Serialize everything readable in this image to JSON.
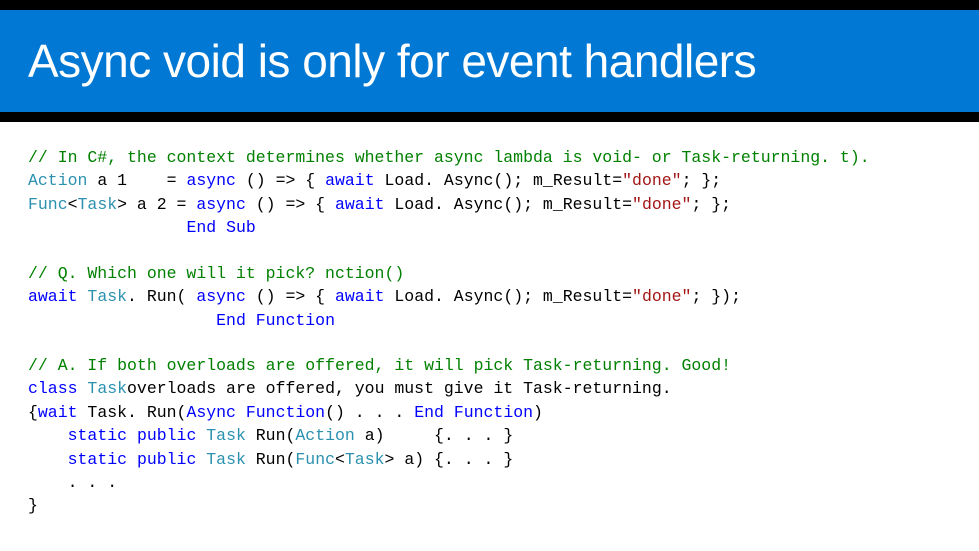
{
  "header": {
    "title": "Async void is only for event handlers"
  },
  "code": {
    "b1": {
      "c1": "// In C#, the context determines whether async lambda is void- or Task-returning. t).",
      "t_action": "Action",
      "l2_a": " a 1    = ",
      "k_async": "async",
      "l2_b": " () => { ",
      "k_await": "await",
      "l2_c": " Load. Async(); m_Result=",
      "s_done": "\"done\"",
      "l2_d": "; };",
      "t_func": "Func",
      "t_task": "Task",
      "lt": "<",
      "gt": ">",
      "l3_a": " a 2 = ",
      "l3_b": " () => { ",
      "l3_c": " Load. Async(); m_Result=",
      "l3_d": "; };",
      "l4_pad": "                ",
      "k_end": "End",
      "sp": " ",
      "k_sub": "Sub"
    },
    "b2": {
      "c1": "// Q. Which one will it pick? nction()",
      "k_await": "await",
      "sp": " ",
      "t_task": "Task",
      "l2_a": ". Run( ",
      "k_async": "async",
      "l2_b": " () => { ",
      "l2_c": " Load. Async(); m_Result=",
      "s_done": "\"done\"",
      "l2_d": "; });",
      "l3_pad": "                   ",
      "k_end": "End",
      "k_function": "Function"
    },
    "b3": {
      "c1": "// A. If both overloads are offered, it will pick Task-returning. Good!",
      "k_class": "class",
      "sp": " ",
      "t_task": "Task",
      "l2_a": "overloads are offered, you must give it Task-returning.",
      "l3_a": "{",
      "k_wait": "wait",
      "l3_b": " Task. Run(",
      "k_async_u": "Async",
      "k_function": "Function",
      "l3_c": "() . . . ",
      "k_end": "End",
      "l3_d": ")",
      "l4_pad": "    ",
      "k_static": "static",
      "k_public": "public",
      "l4_a": " Run(",
      "t_action": "Action",
      "l4_b": " a)     {. . . }",
      "l5_a": " Run(",
      "t_func": "Func",
      "lt": "<",
      "gt": ">",
      "l5_b": " a) {. . . }",
      "l6_pad": "    . . .",
      "l7": "}"
    }
  }
}
